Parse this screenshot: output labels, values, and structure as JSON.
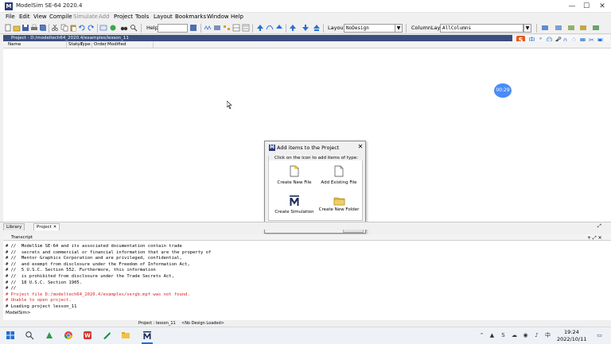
{
  "window": {
    "title": "ModelSim SE-64 2020.4",
    "app_icon_letter": "M",
    "minimize": "—",
    "maximize": "☐",
    "close": "✕"
  },
  "menu": [
    {
      "label": "File",
      "disabled": false
    },
    {
      "label": "Edit",
      "disabled": false
    },
    {
      "label": "View",
      "disabled": false
    },
    {
      "label": "Compile",
      "disabled": false
    },
    {
      "label": "Simulate",
      "disabled": true
    },
    {
      "label": "Add",
      "disabled": true
    },
    {
      "label": "Project",
      "disabled": false
    },
    {
      "label": "Tools",
      "disabled": false
    },
    {
      "label": "Layout",
      "disabled": false
    },
    {
      "label": "Bookmarks",
      "disabled": false
    },
    {
      "label": "Window",
      "disabled": false
    },
    {
      "label": "Help",
      "disabled": false
    }
  ],
  "toolbar": {
    "help_label": "Help",
    "help_value": "",
    "layout_label": "Layout",
    "layout_value": "NoDesign",
    "column_layout_label": "ColumnLayout",
    "column_layout_value": "AllColumns"
  },
  "ime": {
    "logo": "S"
  },
  "project": {
    "window_title": "Project - D:/modeltech64_2020.4/examples/lesson_11",
    "columns": [
      "Name",
      "Status",
      "Type",
      "Order",
      "Modified"
    ]
  },
  "timer": {
    "value": "00:29"
  },
  "dialog": {
    "title": "Add items to the Project",
    "instruction": "Click on the icon to add items of type:",
    "options": [
      {
        "label": "Create New File"
      },
      {
        "label": "Add Existing File"
      },
      {
        "label": "Create Simulation"
      },
      {
        "label": "Create New Folder"
      }
    ],
    "close_button": "Close"
  },
  "tabs": [
    {
      "label": "Library",
      "active": false
    },
    {
      "label": "Project",
      "active": true
    }
  ],
  "transcript": {
    "title": "Transcript",
    "lines": [
      {
        "text": "# //  ModelSim SE-64 and its associated documentation contain trade",
        "error": false
      },
      {
        "text": "# //  secrets and commercial or financial information that are the property of",
        "error": false
      },
      {
        "text": "# //  Mentor Graphics Corporation and are privileged, confidential,",
        "error": false
      },
      {
        "text": "# //  and exempt from disclosure under the Freedom of Information Act,",
        "error": false
      },
      {
        "text": "# //  5 U.S.C. Section 552. Furthermore, this information",
        "error": false
      },
      {
        "text": "# //  is prohibited from disclosure under the Trade Secrets Act,",
        "error": false
      },
      {
        "text": "# //  18 U.S.C. Section 1905.",
        "error": false
      },
      {
        "text": "# //",
        "error": false
      },
      {
        "text": "# Project file D:/modeltech64_2020.4/examples/sergb.mpf was not found.",
        "error": true
      },
      {
        "text": "# Unable to open project.",
        "error": true
      },
      {
        "text": "# Loading project lesson_11",
        "error": false
      },
      {
        "text": "",
        "error": false
      },
      {
        "text": "ModelSim>",
        "error": false
      }
    ]
  },
  "status": {
    "project": "Project : lesson_11",
    "design": "<No Design Loaded>"
  },
  "taskbar": {
    "time": "19:24",
    "date": "2022/10/11"
  }
}
